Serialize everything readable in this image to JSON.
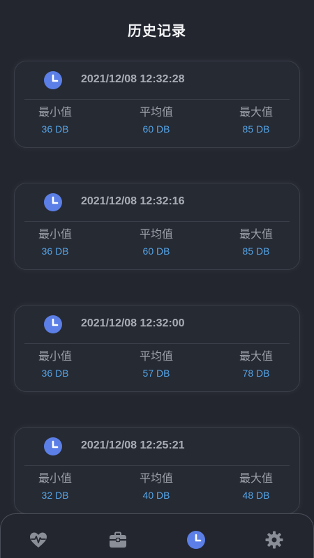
{
  "header": {
    "title": "历史记录"
  },
  "labels": {
    "min": "最小值",
    "avg": "平均值",
    "max": "最大值"
  },
  "records": [
    {
      "time": "2021/12/08 12:32:28",
      "min": "36 DB",
      "avg": "60 DB",
      "max": "85 DB"
    },
    {
      "time": "2021/12/08 12:32:16",
      "min": "36 DB",
      "avg": "60 DB",
      "max": "85 DB"
    },
    {
      "time": "2021/12/08 12:32:00",
      "min": "36 DB",
      "avg": "57 DB",
      "max": "78 DB"
    },
    {
      "time": "2021/12/08 12:25:21",
      "min": "32 DB",
      "avg": "40 DB",
      "max": "48 DB"
    }
  ],
  "tabbar": {
    "items": [
      {
        "icon": "heart-pulse-icon",
        "active": false
      },
      {
        "icon": "toolbox-icon",
        "active": false
      },
      {
        "icon": "clock-icon",
        "active": true
      },
      {
        "icon": "gear-icon",
        "active": false
      }
    ]
  },
  "colors": {
    "background": "#23262f",
    "accent": "#5b7fe6",
    "value": "#55a4e6",
    "icon_inactive": "#8a8e96"
  }
}
